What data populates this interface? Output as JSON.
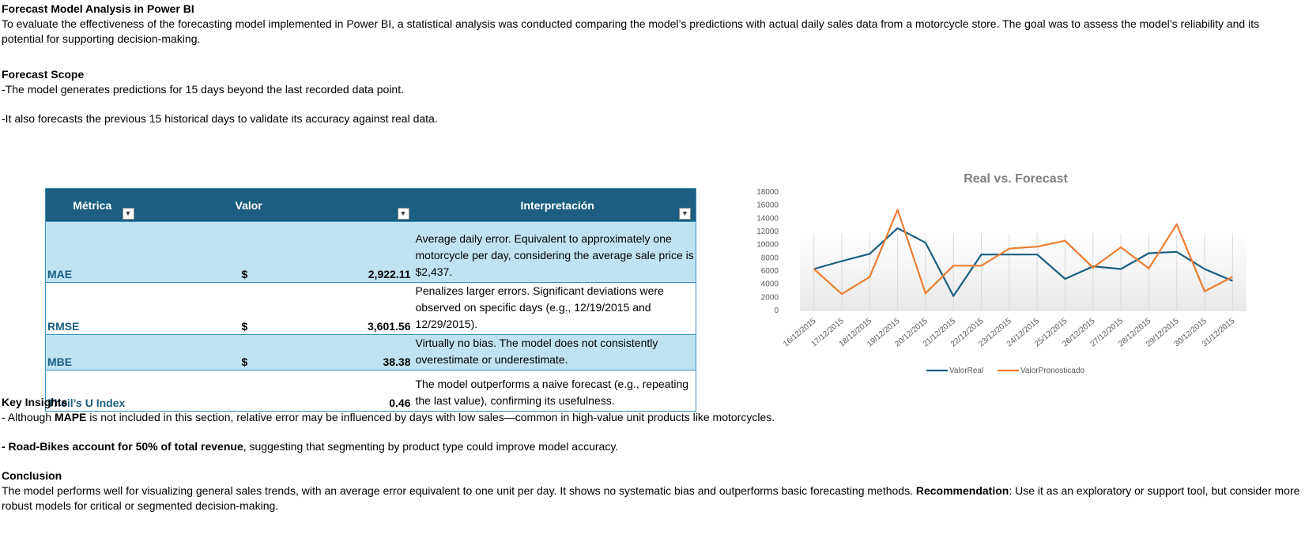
{
  "intro": {
    "title": "Forecast Model Analysis in Power BI",
    "paragraph": "To evaluate the effectiveness of the forecasting model implemented in Power BI, a statistical analysis was conducted comparing the model’s predictions with actual daily sales data from a motorcycle store. The goal was to assess the model’s reliability and its potential for supporting decision-making."
  },
  "scope": {
    "title": "Forecast Scope",
    "line1": "-The model generates predictions for 15 days beyond the last recorded data point.",
    "line2": "-It also forecasts the previous 15 historical days to validate its accuracy against real data."
  },
  "table": {
    "headers": [
      "Métrica",
      "Valor",
      "Interpretación"
    ],
    "rows": [
      {
        "metric": "MAE",
        "currency": "$",
        "value": "2,922.11",
        "interp": "Average daily error. Equivalent to approximately one motorcycle per day, considering the average sale price is $2,437."
      },
      {
        "metric": "RMSE",
        "currency": "$",
        "value": "3,601.56",
        "interp": "Penalizes larger errors. Significant deviations were observed on specific days (e.g., 12/19/2015 and 12/29/2015)."
      },
      {
        "metric": "MBE",
        "currency": "$",
        "value": "38.38",
        "interp": "Virtually no bias. The model does not consistently overestimate or underestimate."
      },
      {
        "metric": "Theil’s U Index",
        "currency": "",
        "value": "0.46",
        "interp": "The model outperforms a naive forecast (e.g., repeating the last value), confirming its usefulness."
      }
    ]
  },
  "insights": {
    "title": "Key Insights",
    "line1_pre": "- Although ",
    "line1_bold": "MAPE",
    "line1_post": " is not included in this section, relative error may be influenced by days with low sales—common in high-value unit products like motorcycles.",
    "line2_bold": "- Road-Bikes account for 50% of total revenue",
    "line2_post": ", suggesting that segmenting by product type could improve model accuracy."
  },
  "conclusion": {
    "title": "Conclusion",
    "pre": "The model performs well for visualizing general sales trends, with an average error equivalent to one unit per day. It shows no systematic bias and outperforms basic forecasting methods. ",
    "bold": "Recommendation",
    "post": ": Use it as an exploratory or support tool, but consider more robust models for critical or segmented decision-making."
  },
  "chart_data": {
    "type": "line",
    "title": "Real vs. Forecast",
    "categories": [
      "16/12/2015",
      "17/12/2015",
      "18/12/2015",
      "19/12/2015",
      "20/12/2015",
      "21/12/2015",
      "22/12/2015",
      "23/12/2015",
      "24/12/2015",
      "25/12/2015",
      "26/12/2015",
      "27/12/2015",
      "28/12/2015",
      "29/12/2015",
      "30/12/2015",
      "31/12/2015"
    ],
    "yticks": [
      0,
      2000,
      4000,
      6000,
      8000,
      10000,
      12000,
      14000,
      16000,
      18000
    ],
    "ylim": [
      0,
      18000
    ],
    "series": [
      {
        "name": "ValorReal",
        "color": "#1b5e80",
        "values": [
          6300,
          7500,
          8600,
          12500,
          10300,
          2200,
          8500,
          8500,
          8500,
          4800,
          6700,
          6300,
          8700,
          8900,
          6300,
          4500
        ]
      },
      {
        "name": "ValorPronosticado",
        "color": "#ed7d31",
        "values": [
          6300,
          2500,
          5100,
          15300,
          2600,
          6800,
          6800,
          9400,
          9700,
          10600,
          6500,
          9600,
          6400,
          13100,
          2900,
          5100
        ]
      }
    ],
    "legend_position": "bottom",
    "grid": true
  }
}
